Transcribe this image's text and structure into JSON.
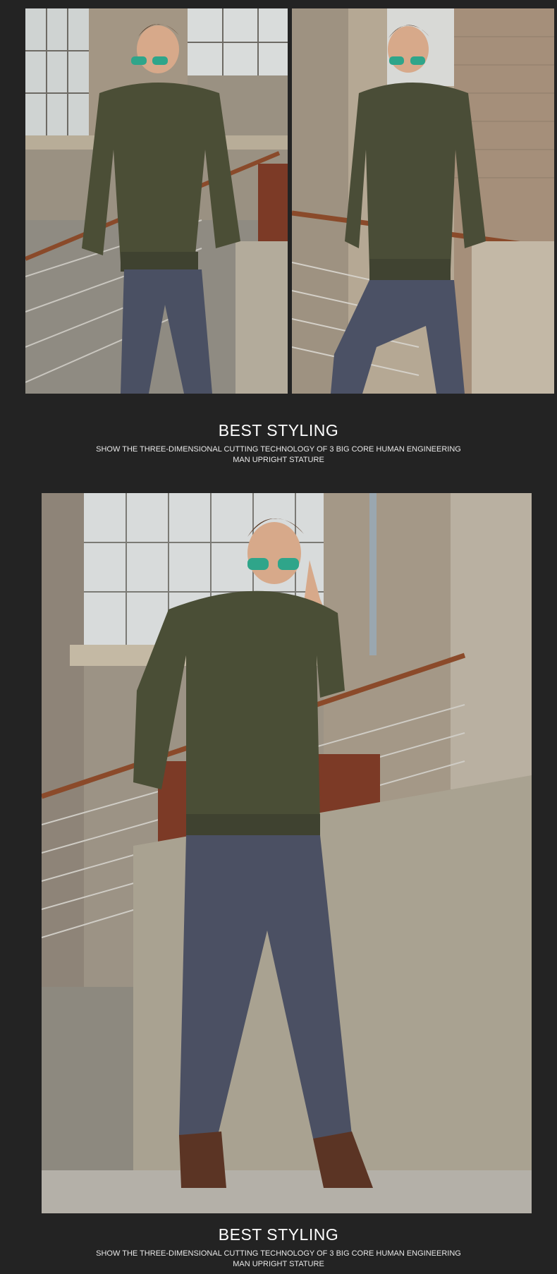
{
  "colors": {
    "page_background": "#232323",
    "title_text": "#ffffff",
    "body_text": "#e8e8e8"
  },
  "photos": {
    "left": {
      "subject": "model in olive jacket and mirrored sunglasses, hand in pocket"
    },
    "right": {
      "subject": "model in olive jacket leaning on railing, knee raised"
    },
    "main": {
      "subject": "full-length model in olive jacket, grey trousers and brown boots"
    }
  },
  "sections": [
    {
      "title": "BEST STYLING",
      "description": "SHOW THE THREE-DIMENSIONAL CUTTING TECHNOLOGY OF 3 BIG CORE HUMAN ENGINEERING MAN UPRIGHT STATURE"
    },
    {
      "title": "BEST STYLING",
      "description": "SHOW THE THREE-DIMENSIONAL CUTTING TECHNOLOGY OF 3 BIG CORE HUMAN ENGINEERING MAN UPRIGHT STATURE"
    }
  ]
}
